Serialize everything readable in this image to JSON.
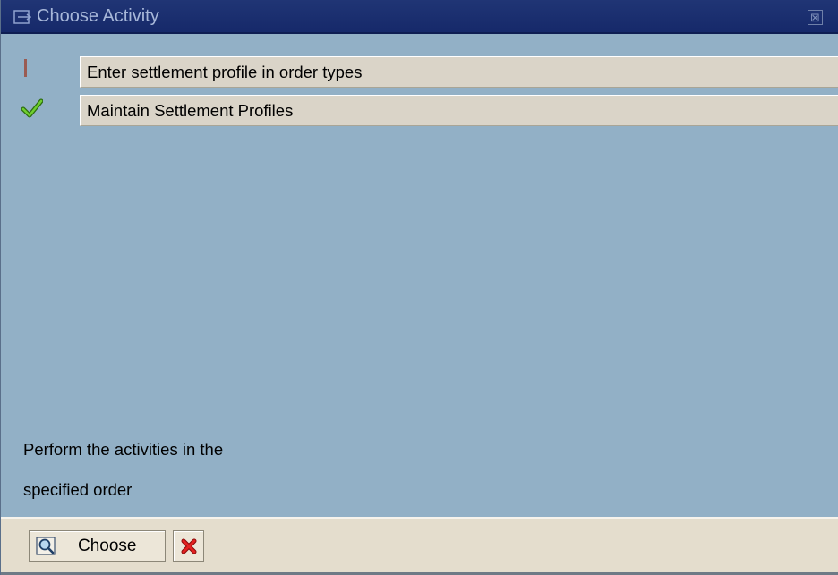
{
  "window": {
    "title": "Choose Activity",
    "title_icon": "dialog-arrow-icon",
    "close_icon": "close-icon",
    "close_glyph": "⊠"
  },
  "activities": [
    {
      "label": "Enter settlement profile in order types",
      "status": "current",
      "status_icon": "current-step-marker-icon"
    },
    {
      "label": "Maintain Settlement Profiles",
      "status": "completed",
      "status_icon": "green-check-icon"
    }
  ],
  "note": {
    "line1": "Perform the activities in the",
    "line2": "specified order"
  },
  "footer": {
    "choose_label": "Choose",
    "choose_icon": "choose-magnifier-icon",
    "cancel_icon": "cancel-x-icon"
  },
  "colors": {
    "titlebar": "#203575",
    "body_background": "#92b0c6",
    "row_background": "#dad4c8",
    "footer_background": "#e4ddcd",
    "check_green": "#44a81a",
    "cancel_red": "#d81818"
  }
}
